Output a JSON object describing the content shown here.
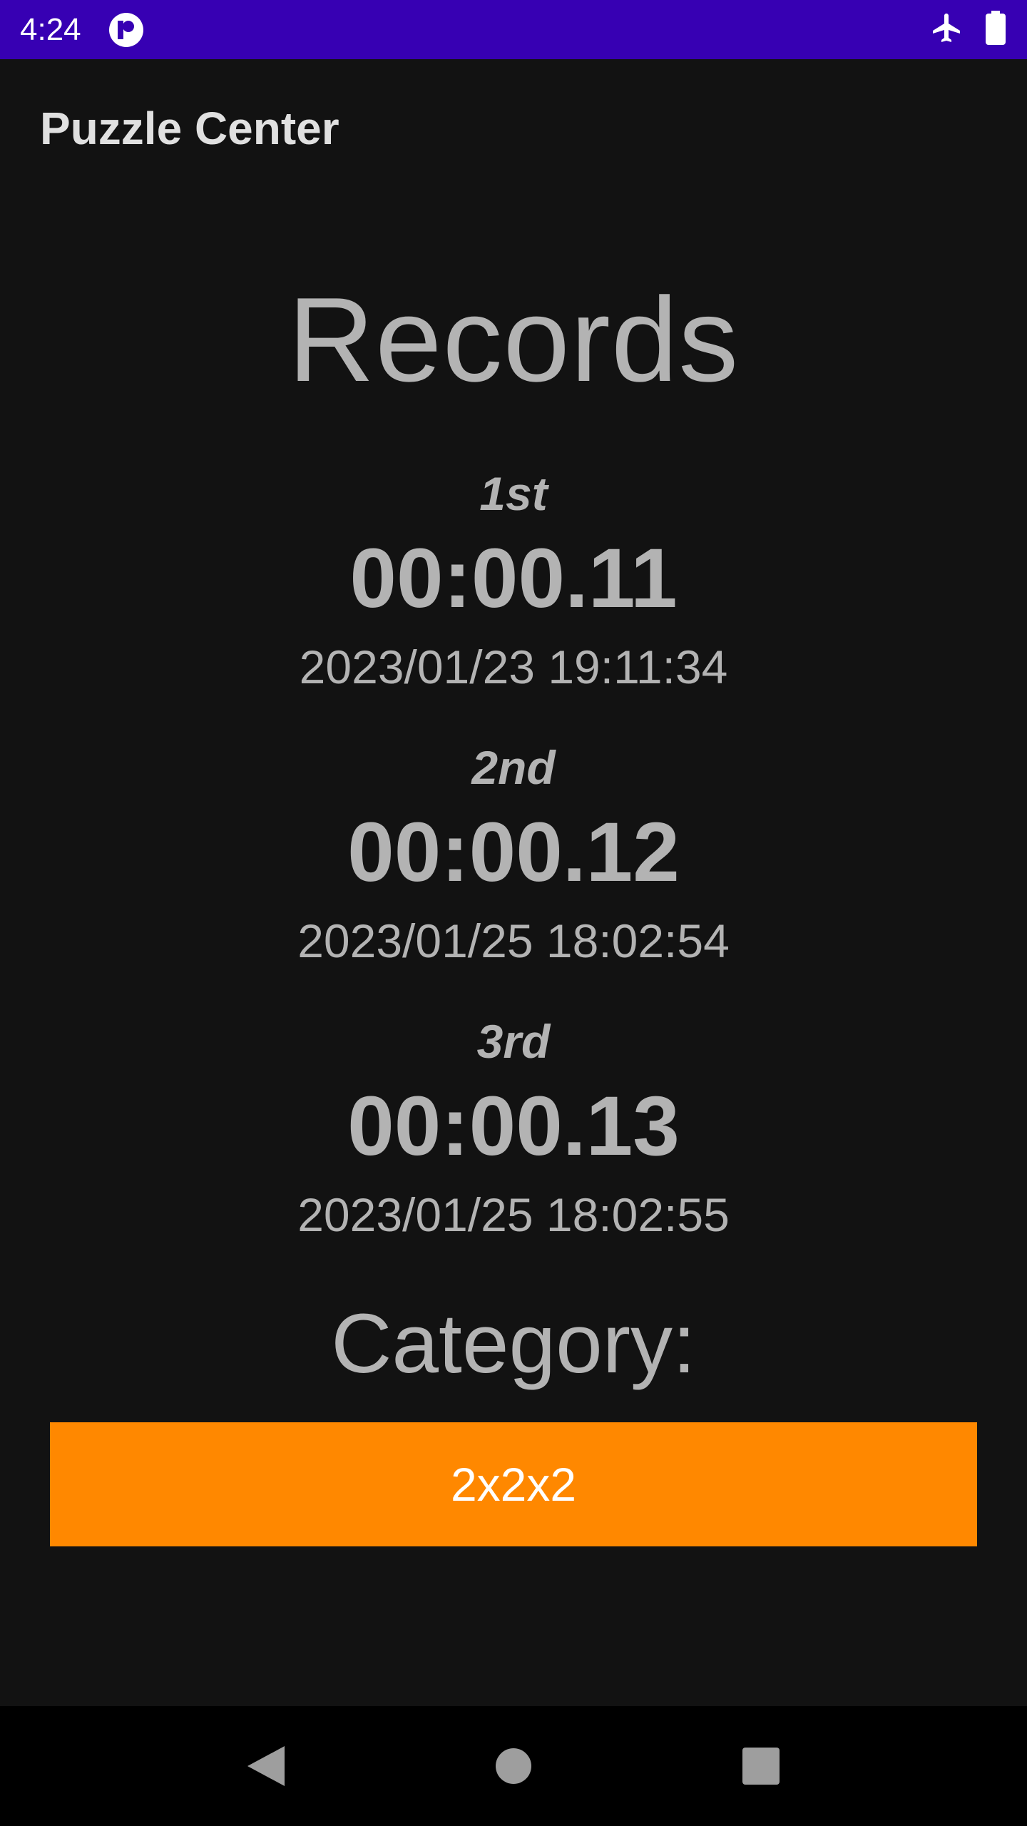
{
  "status_bar": {
    "time": "4:24",
    "icons": [
      "app-notification-icon",
      "airplane-mode-icon",
      "battery-icon"
    ]
  },
  "app_bar": {
    "title": "Puzzle Center"
  },
  "main": {
    "heading": "Records",
    "records": [
      {
        "rank": "1st",
        "time": "00:00.11",
        "date": "2023/01/23 19:11:34"
      },
      {
        "rank": "2nd",
        "time": "00:00.12",
        "date": "2023/01/25 18:02:54"
      },
      {
        "rank": "3rd",
        "time": "00:00.13",
        "date": "2023/01/25 18:02:55"
      }
    ],
    "category_label": "Category:",
    "category_value": "2x2x2"
  },
  "nav_bar": {
    "icons": [
      "back-icon",
      "home-icon",
      "recents-icon"
    ]
  },
  "colors": {
    "status_bar": "#3700b3",
    "background": "#121212",
    "accent": "#ff8800",
    "text": "#b3b3b3"
  }
}
